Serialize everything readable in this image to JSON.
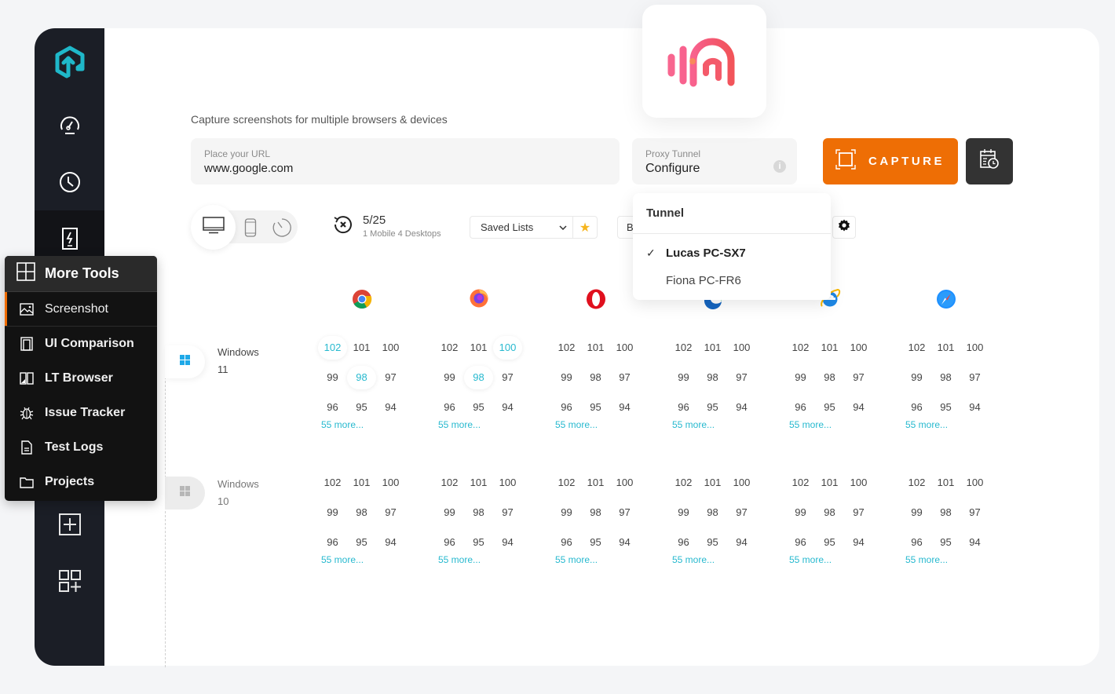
{
  "app": {
    "subtitle": "Capture screenshots for multiple browsers & devices"
  },
  "url_field": {
    "label": "Place your URL",
    "value": "www.google.com"
  },
  "proxy_field": {
    "label": "Proxy Tunnel",
    "value": "Configure",
    "info": "i"
  },
  "capture_button": {
    "label": "CAPTURE"
  },
  "toolbar": {
    "count": "5/25",
    "count_detail": "1 Mobile 4 Desktops",
    "saved_lists_label": "Saved Lists",
    "b_button_label": "B"
  },
  "tunnel_dropdown": {
    "title": "Tunnel",
    "options": [
      {
        "label": "Lucas PC-SX7",
        "selected": true,
        "check": "✓"
      },
      {
        "label": "Fiona PC-FR6",
        "selected": false,
        "check": ""
      }
    ]
  },
  "sidebar": {
    "icons": [
      "logo-icon",
      "dashboard-icon",
      "history-icon",
      "lightning-device-icon",
      "add-icon",
      "apps-add-icon"
    ]
  },
  "more_tools": {
    "title": "More Tools",
    "items": [
      {
        "label": "Screenshot",
        "icon": "image-icon",
        "active": true
      },
      {
        "label": "UI Comparison",
        "icon": "compare-icon",
        "active": false
      },
      {
        "label": "LT Browser",
        "icon": "browser-icon",
        "active": false
      },
      {
        "label": "Issue Tracker",
        "icon": "bug-icon",
        "active": false
      },
      {
        "label": "Test Logs",
        "icon": "document-icon",
        "active": false
      },
      {
        "label": "Projects",
        "icon": "folder-icon",
        "active": false
      }
    ]
  },
  "browsers": [
    {
      "name": "chrome"
    },
    {
      "name": "firefox"
    },
    {
      "name": "opera"
    },
    {
      "name": "edge"
    },
    {
      "name": "internet-explorer"
    },
    {
      "name": "safari"
    }
  ],
  "os_rows": [
    {
      "name_line1": "Windows",
      "name_line2": "11",
      "active": true,
      "versions": [
        {
          "rows": [
            [
              "102",
              "101",
              "100"
            ],
            [
              "99",
              "98",
              "97"
            ],
            [
              "96",
              "95",
              "94"
            ]
          ],
          "selected": [
            "102",
            "98"
          ],
          "more": "55 more..."
        },
        {
          "rows": [
            [
              "102",
              "101",
              "100"
            ],
            [
              "99",
              "98",
              "97"
            ],
            [
              "96",
              "95",
              "94"
            ]
          ],
          "selected": [
            "100",
            "98"
          ],
          "more": "55 more..."
        },
        {
          "rows": [
            [
              "102",
              "101",
              "100"
            ],
            [
              "99",
              "98",
              "97"
            ],
            [
              "96",
              "95",
              "94"
            ]
          ],
          "selected": [],
          "more": "55 more..."
        },
        {
          "rows": [
            [
              "102",
              "101",
              "100"
            ],
            [
              "99",
              "98",
              "97"
            ],
            [
              "96",
              "95",
              "94"
            ]
          ],
          "selected": [],
          "more": "55 more..."
        },
        {
          "rows": [
            [
              "102",
              "101",
              "100"
            ],
            [
              "99",
              "98",
              "97"
            ],
            [
              "96",
              "95",
              "94"
            ]
          ],
          "selected": [],
          "more": "55 more..."
        },
        {
          "rows": [
            [
              "102",
              "101",
              "100"
            ],
            [
              "99",
              "98",
              "97"
            ],
            [
              "96",
              "95",
              "94"
            ]
          ],
          "selected": [],
          "more": "55 more..."
        }
      ]
    },
    {
      "name_line1": "Windows",
      "name_line2": "10",
      "active": false,
      "versions": [
        {
          "rows": [
            [
              "102",
              "101",
              "100"
            ],
            [
              "99",
              "98",
              "97"
            ],
            [
              "96",
              "95",
              "94"
            ]
          ],
          "selected": [],
          "more": "55 more..."
        },
        {
          "rows": [
            [
              "102",
              "101",
              "100"
            ],
            [
              "99",
              "98",
              "97"
            ],
            [
              "96",
              "95",
              "94"
            ]
          ],
          "selected": [],
          "more": "55 more..."
        },
        {
          "rows": [
            [
              "102",
              "101",
              "100"
            ],
            [
              "99",
              "98",
              "97"
            ],
            [
              "96",
              "95",
              "94"
            ]
          ],
          "selected": [],
          "more": "55 more..."
        },
        {
          "rows": [
            [
              "102",
              "101",
              "100"
            ],
            [
              "99",
              "98",
              "97"
            ],
            [
              "96",
              "95",
              "94"
            ]
          ],
          "selected": [],
          "more": "55 more..."
        },
        {
          "rows": [
            [
              "102",
              "101",
              "100"
            ],
            [
              "99",
              "98",
              "97"
            ],
            [
              "96",
              "95",
              "94"
            ]
          ],
          "selected": [],
          "more": "55 more..."
        },
        {
          "rows": [
            [
              "102",
              "101",
              "100"
            ],
            [
              "99",
              "98",
              "97"
            ],
            [
              "96",
              "95",
              "94"
            ]
          ],
          "selected": [],
          "more": "55 more..."
        }
      ]
    }
  ],
  "colors": {
    "accent_orange": "#ee6e05",
    "accent_teal": "#27b9cf",
    "sidebar_dark": "#1b1e26"
  }
}
